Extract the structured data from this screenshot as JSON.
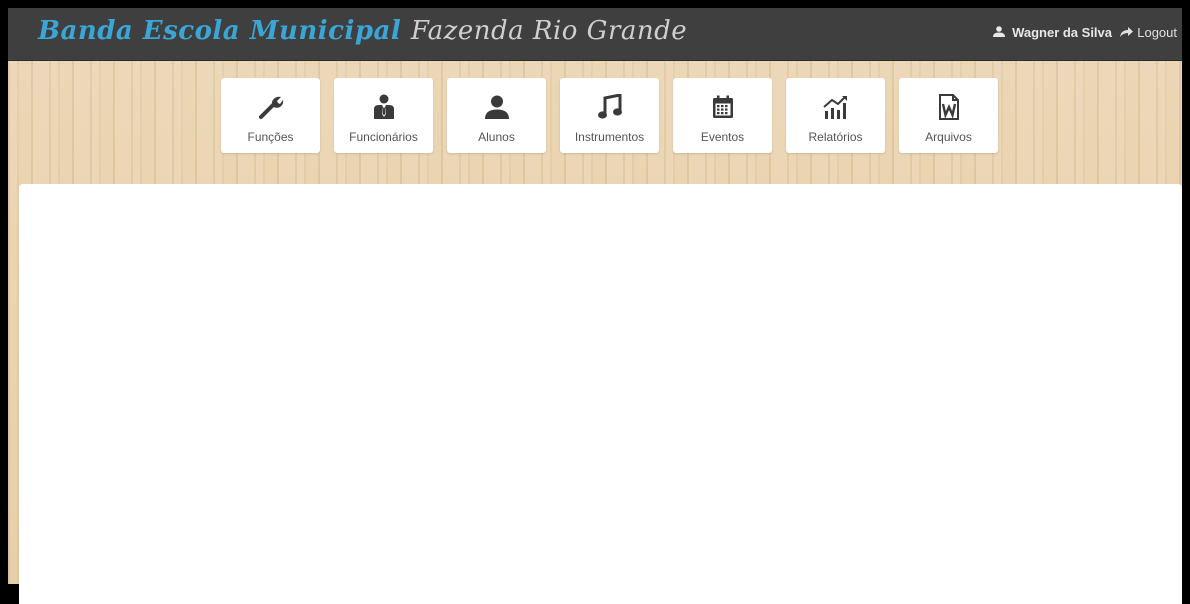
{
  "header": {
    "brand_part1": "Banda Escola Municipal",
    "brand_part2": "Fazenda Rio Grande",
    "user_name": "Wagner da Silva",
    "logout_label": "Logout",
    "colors": {
      "brand_blue": "#3aa6d6",
      "bar_bg": "#3f3f3f"
    }
  },
  "nav": {
    "items": [
      {
        "label": "Funções",
        "icon": "wrench-icon"
      },
      {
        "label": "Funcionários",
        "icon": "employee-icon"
      },
      {
        "label": "Alunos",
        "icon": "user-icon"
      },
      {
        "label": "Instrumentos",
        "icon": "music-note-icon"
      },
      {
        "label": "Eventos",
        "icon": "calendar-icon"
      },
      {
        "label": "Relatórios",
        "icon": "chart-icon"
      },
      {
        "label": "Arquivos",
        "icon": "word-file-icon"
      }
    ]
  }
}
